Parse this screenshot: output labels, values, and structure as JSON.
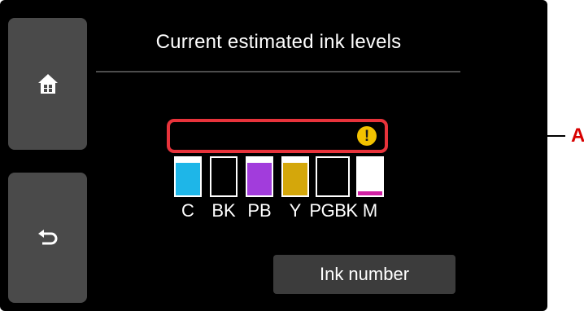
{
  "screen": {
    "title": "Current estimated ink levels",
    "status_warning_icon": "exclamation-warning-icon",
    "status_border_color": "#e8333b",
    "buttons": {
      "home_icon": "home-icon",
      "back_icon": "back-arrow-icon",
      "ink_number_label": "Ink number"
    },
    "inks": [
      {
        "label": "C",
        "color": "#1eb6e8",
        "level": 0.88
      },
      {
        "label": "BK",
        "color": "#000000",
        "level": 0.88
      },
      {
        "label": "PB",
        "color": "#a23cdc",
        "level": 0.88
      },
      {
        "label": "Y",
        "color": "#d4a70b",
        "level": 0.88
      },
      {
        "label": "PGBK",
        "color": "#000000",
        "level": 0.88
      },
      {
        "label": "M",
        "color": "#d11fa3",
        "level": 0.1
      }
    ]
  },
  "callout": {
    "label": "A",
    "color": "#d80000"
  }
}
